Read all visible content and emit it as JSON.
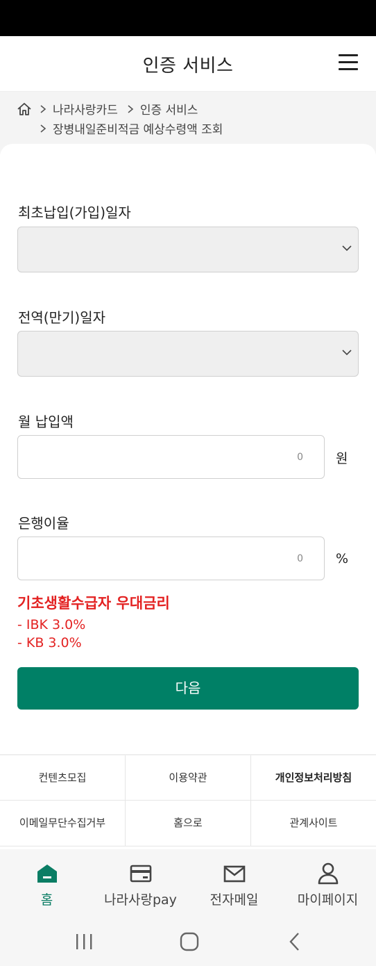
{
  "header": {
    "title": "인증 서비스",
    "menu_icon": "hamburger-menu-icon"
  },
  "breadcrumb": {
    "home_icon": "home-icon",
    "items": [
      "나라사랑카드",
      "인증 서비스",
      "장병내일준비적금 예상수령액 조회"
    ]
  },
  "form": {
    "first_payment_label": "최초납입(가입)일자",
    "first_payment_value": "",
    "discharge_label": "전역(만기)일자",
    "discharge_value": "",
    "monthly_label": "월 납입액",
    "monthly_value": "0",
    "monthly_unit": "원",
    "rate_label": "은행이율",
    "rate_value": "0",
    "rate_unit": "%"
  },
  "notice": {
    "heading": "기초생활수급자 우대금리",
    "lines": [
      "- IBK 3.0%",
      "- KB 3.0%"
    ],
    "color": "#e32222"
  },
  "next_button": {
    "label": "다음",
    "color": "#008066"
  },
  "footer_links": [
    "컨텐츠모집",
    "이용약관",
    "개인정보처리방침",
    "이메일무단수집거부",
    "홈으로",
    "관계사이트"
  ],
  "bottom_nav": [
    {
      "label": "홈",
      "icon": "home-icon",
      "active": true
    },
    {
      "label": "나라사랑pay",
      "icon": "card-icon",
      "active": false
    },
    {
      "label": "전자메일",
      "icon": "mail-icon",
      "active": false
    },
    {
      "label": "마이페이지",
      "icon": "person-icon",
      "active": false
    }
  ],
  "system_nav": [
    "recent-apps-icon",
    "home-circle-icon",
    "back-icon"
  ],
  "colors": {
    "accent": "#008066",
    "active_nav": "#0a7d64",
    "warning": "#e32222"
  }
}
